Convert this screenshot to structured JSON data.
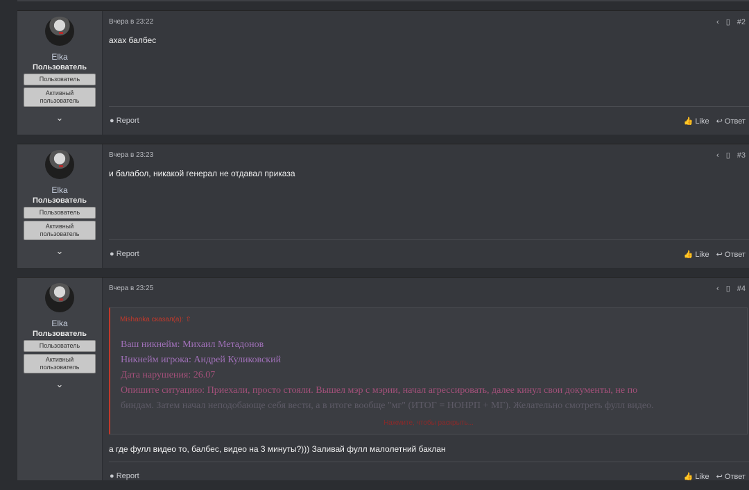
{
  "posts": [
    {
      "user": {
        "name": "Elka",
        "role": "Пользователь",
        "badges": [
          "Пользователь",
          "Активный пользователь"
        ]
      },
      "date": "Вчера в 23:22",
      "number": "#2",
      "message": "ахах балбес",
      "footer": {
        "report": "Report",
        "like": "Like",
        "reply": "Ответ"
      }
    },
    {
      "user": {
        "name": "Elka",
        "role": "Пользователь",
        "badges": [
          "Пользователь",
          "Активный пользователь"
        ]
      },
      "date": "Вчера в 23:23",
      "number": "#3",
      "message": "и балабол, никакой генерал не отдавал приказа",
      "footer": {
        "report": "Report",
        "like": "Like",
        "reply": "Ответ"
      }
    },
    {
      "user": {
        "name": "Elka",
        "role": "Пользователь",
        "badges": [
          "Пользователь",
          "Активный пользователь"
        ]
      },
      "date": "Вчера в 23:25",
      "number": "#4",
      "quote": {
        "header": "Mishanka сказал(а):",
        "lines": [
          "Ваш никнейм: Михаил Метадонов",
          "Никнейм игрока: Андрей Куликовский",
          "Дата нарушения: 26.07",
          "Опишите ситуацию: Приехали, просто стояли. Вышел мэр с мэрии, начал агрессировать, далее кинул свои документы, не по",
          "биндам. Затем начал неподобающе себя вести, а в итоге вообще \"мг\" (ИТОГ = НОНРП + МГ). Желательно смотреть фулл видео."
        ],
        "expand": "Нажмите, чтобы раскрыть..."
      },
      "message": "а где фулл видео то, балбес, видео на 3 минуты?))) Заливай фулл малолетний баклан",
      "footer": {
        "report": "Report",
        "like": "Like",
        "reply": "Ответ"
      }
    }
  ],
  "icons": {
    "share": "share-icon",
    "bookmark": "bookmark-icon",
    "report": "report-icon",
    "like": "like-icon",
    "reply": "reply-icon",
    "expand": "chevron-down-icon",
    "quote_jump": "arrow-up-circle-icon"
  }
}
